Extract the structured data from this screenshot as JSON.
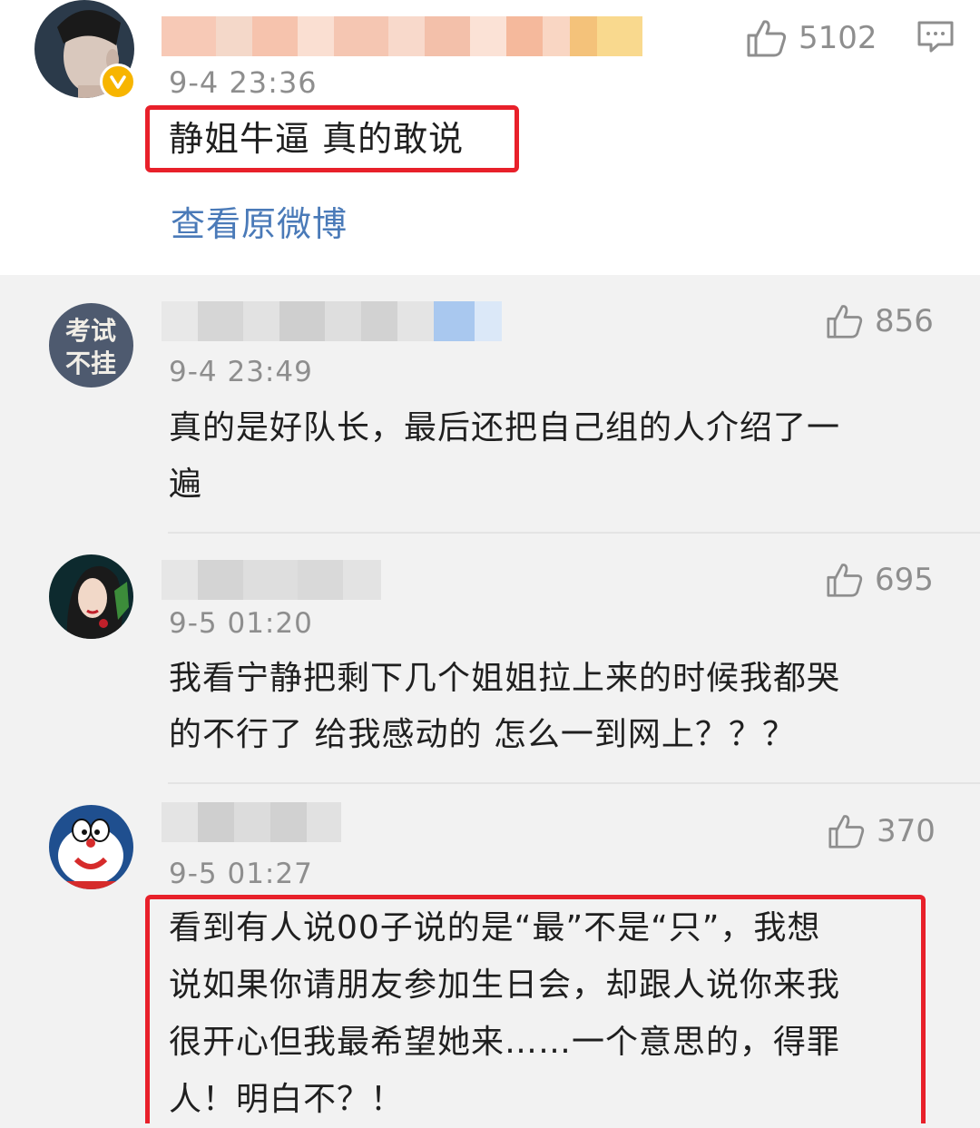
{
  "main_post": {
    "time": "9-4 23:36",
    "likes": "5102",
    "comment": "静姐牛逼 真的敢说",
    "view_original": "查看原微博"
  },
  "replies": [
    {
      "time": "9-4 23:49",
      "likes": "856",
      "avatar_text_line1": "考试",
      "avatar_text_line2": "不挂",
      "lines": [
        "真的是好队长，最后还把自己组的人介绍了一",
        "遍"
      ]
    },
    {
      "time": "9-5 01:20",
      "likes": "695",
      "lines": [
        "我看宁静把剩下几个姐姐拉上来的时候我都哭",
        "的不行了 给我感动的 怎么一到网上？？？"
      ]
    },
    {
      "time": "9-5 01:27",
      "likes": "370",
      "lines": [
        "看到有人说00子说的是“最”不是“只”，我想",
        "说如果你请朋友参加生日会，却跟人说你来我",
        "很开心但我最希望她来……一个意思的，得罪",
        "人！明白不？！"
      ]
    }
  ],
  "colors": {
    "highlight": "#e8202a",
    "link": "#4a7ab8",
    "meta": "#8e8e8e",
    "verified": "#f7b500"
  },
  "icons": [
    "thumbs-up-icon",
    "comment-icon",
    "verified-icon"
  ]
}
